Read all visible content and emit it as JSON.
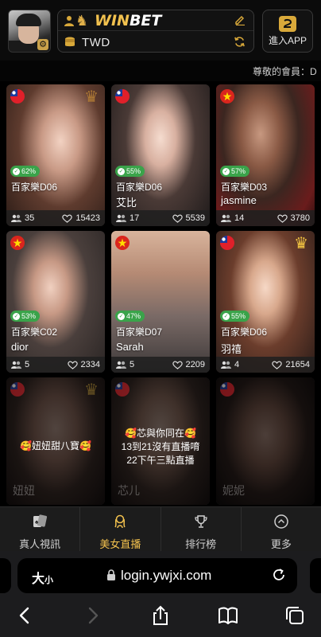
{
  "header": {
    "brand": {
      "win": "WIN",
      "bet": "BET"
    },
    "currency": "TWD",
    "app_button_label": "進入APP"
  },
  "marquee": {
    "text": "尊敬的會員：D"
  },
  "cards": [
    {
      "flag": "taiwan",
      "crown": true,
      "pct": "62%",
      "table": "百家樂D06",
      "name": "",
      "viewers": "35",
      "likes": "15423"
    },
    {
      "flag": "taiwan",
      "crown": false,
      "pct": "55%",
      "table": "百家樂D06",
      "name": "艾比",
      "viewers": "17",
      "likes": "5539"
    },
    {
      "flag": "vietnam",
      "crown": false,
      "pct": "57%",
      "table": "百家樂D03",
      "name": "jasmine",
      "viewers": "14",
      "likes": "3780"
    },
    {
      "flag": "vietnam",
      "crown": false,
      "pct": "53%",
      "table": "百家樂C02",
      "name": "dior",
      "viewers": "5",
      "likes": "2334"
    },
    {
      "flag": "vietnam",
      "crown": false,
      "pct": "47%",
      "table": "百家樂D07",
      "name": "Sarah",
      "viewers": "5",
      "likes": "2209"
    },
    {
      "flag": "taiwan",
      "crown": true,
      "pct": "55%",
      "table": "百家樂D06",
      "name": "羽禧",
      "viewers": "4",
      "likes": "21654"
    }
  ],
  "offline_cards": [
    {
      "flag": "taiwan",
      "crown": true,
      "notice": [
        "🥰妞妞甜八寶🥰"
      ],
      "ghost_name": "妞妞"
    },
    {
      "flag": "taiwan",
      "crown": false,
      "notice": [
        "🥰芯與你同在🥰",
        "13到21沒有直播唷",
        "22下午三點直播"
      ],
      "ghost_name": "芯儿"
    },
    {
      "flag": "taiwan",
      "crown": false,
      "notice": [],
      "ghost_name": "妮妮"
    }
  ],
  "tabs": [
    {
      "label": "真人視訊",
      "icon": "cards-icon",
      "active": false
    },
    {
      "label": "美女直播",
      "icon": "goddess-icon",
      "active": true
    },
    {
      "label": "排行榜",
      "icon": "trophy-icon",
      "active": false
    },
    {
      "label": "更多",
      "icon": "chevron-up-circle-icon",
      "active": false
    }
  ],
  "browser": {
    "text_size_label": "大",
    "text_size_small": "小",
    "url": "login.ywjxi.com"
  },
  "colors": {
    "accent": "#f2c14e",
    "badge_green": "#3aa34a",
    "taiwan_red": "#e0202a",
    "vietnam_red": "#da251d"
  }
}
